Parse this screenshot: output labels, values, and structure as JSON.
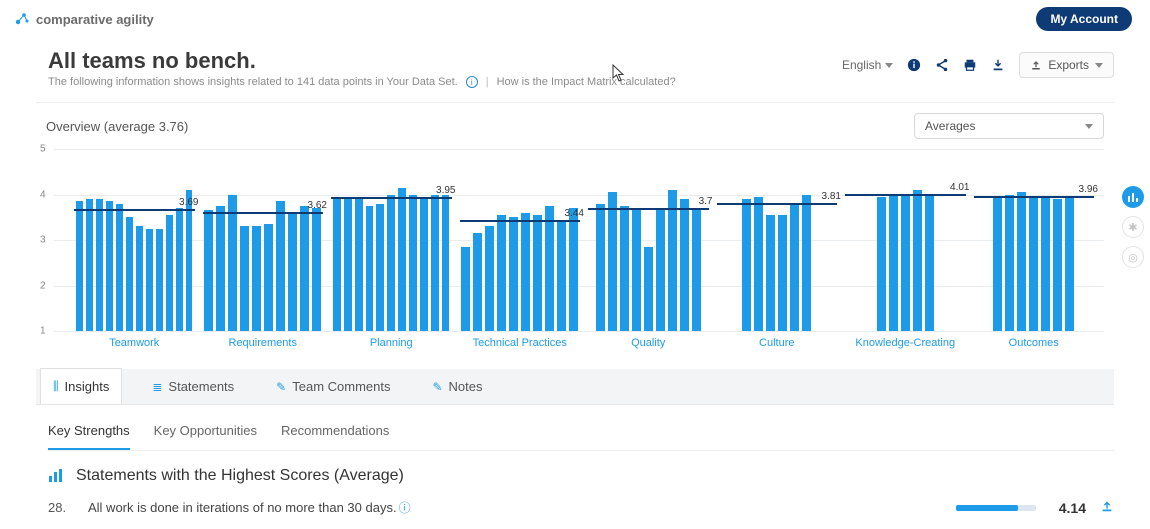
{
  "brand": "comparative agility",
  "account_btn": "My Account",
  "page_title": "All teams no bench.",
  "subtitle_prefix": "The following information shows insights related to 141 data points in Your Data Set.",
  "impact_link": "How is the Impact Matrix calculated?",
  "header_actions": {
    "language": "English",
    "exports": "Exports"
  },
  "overview_label": "Overview (average 3.76)",
  "dropdown_selected": "Averages",
  "chart_data": {
    "type": "bar",
    "ylim": [
      1,
      5
    ],
    "ylabel": "",
    "xlabel": "",
    "categories": [
      "Teamwork",
      "Requirements",
      "Planning",
      "Technical Practices",
      "Quality",
      "Culture",
      "Knowledge-Creating",
      "Outcomes"
    ],
    "group_averages": [
      3.69,
      3.62,
      3.95,
      3.44,
      3.7,
      3.81,
      4.01,
      3.96
    ],
    "group_average_labels": [
      "3.69",
      "3.62",
      "3.95",
      "3.44",
      "3.7",
      "3.81",
      "4.01",
      "3.96"
    ],
    "series_per_group": [
      [
        3.85,
        3.9,
        3.9,
        3.85,
        3.8,
        3.5,
        3.3,
        3.25,
        3.25,
        3.55,
        3.7,
        4.1
      ],
      [
        3.65,
        3.75,
        4.0,
        3.3,
        3.3,
        3.35,
        3.85,
        3.6,
        3.75,
        3.7
      ],
      [
        3.9,
        3.95,
        3.95,
        3.75,
        3.8,
        4.0,
        4.15,
        4.0,
        3.95,
        4.0,
        4.0
      ],
      [
        2.85,
        3.15,
        3.3,
        3.55,
        3.5,
        3.6,
        3.55,
        3.75,
        3.45,
        3.7
      ],
      [
        3.8,
        4.05,
        3.75,
        3.7,
        2.85,
        3.7,
        4.1,
        3.9,
        3.65
      ],
      [
        3.9,
        3.95,
        3.55,
        3.55,
        3.8,
        4.0
      ],
      [
        3.95,
        4.0,
        4.0,
        4.1,
        4.0
      ],
      [
        3.95,
        4.0,
        4.05,
        3.95,
        3.95,
        3.9,
        3.95
      ]
    ]
  },
  "tabs": {
    "insights": "Insights",
    "statements": "Statements",
    "team_comments": "Team Comments",
    "notes": "Notes"
  },
  "subtabs": {
    "key_strengths": "Key Strengths",
    "key_opportunities": "Key Opportunities",
    "recommendations": "Recommendations"
  },
  "insights_heading": "Statements with the Highest Scores (Average)",
  "statement": {
    "num": "28.",
    "text": "All work is done in iterations of no more than 30 days.",
    "score": "4.14",
    "fill_pct": 78
  }
}
